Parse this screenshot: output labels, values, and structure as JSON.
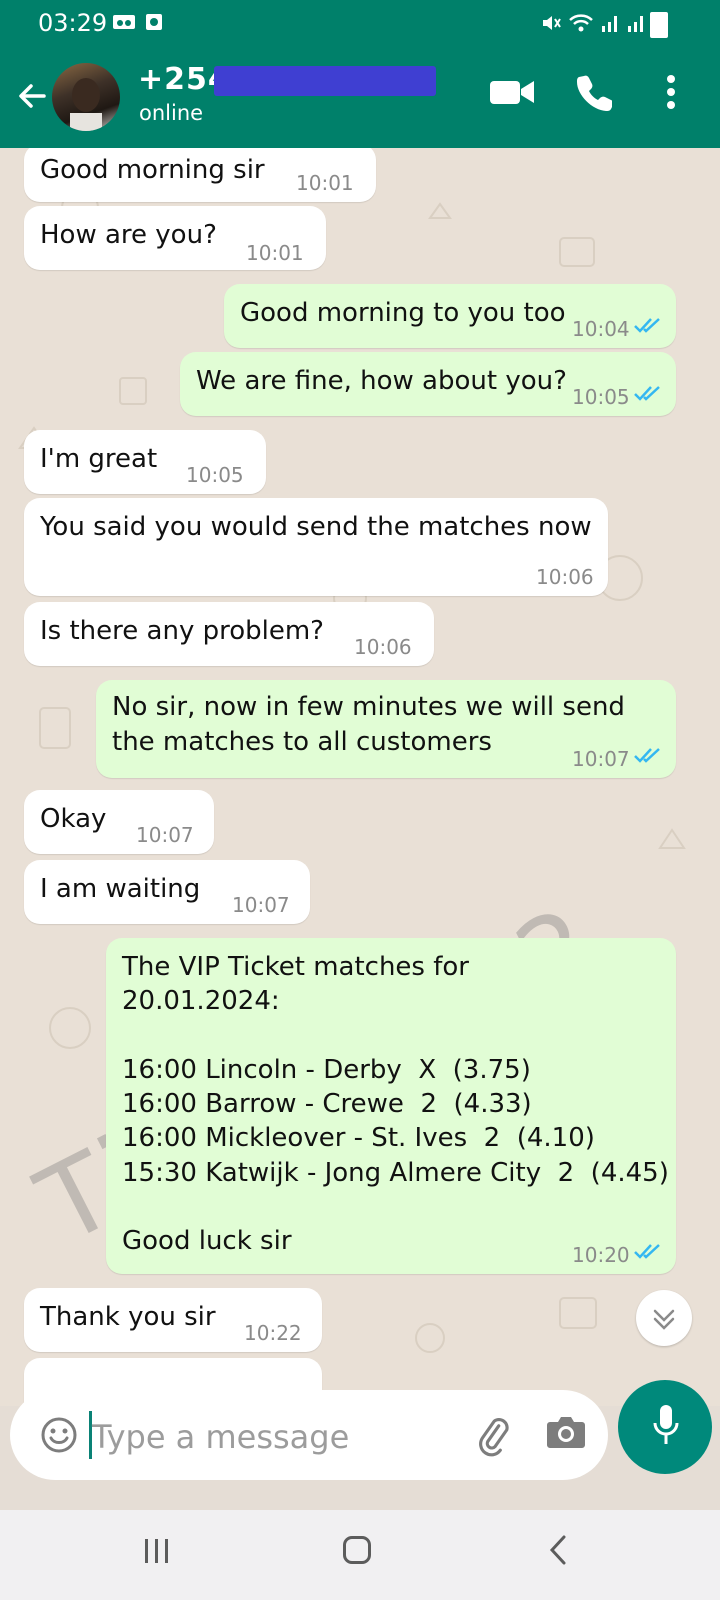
{
  "status_bar": {
    "time": "03:29"
  },
  "header": {
    "contact_name": "+254",
    "status": "online"
  },
  "messages": [
    {
      "side": "in",
      "text": "Good morning sir",
      "time": "10:01"
    },
    {
      "side": "in",
      "text": "How are you?",
      "time": "10:01"
    },
    {
      "side": "out",
      "text": "Good morning to you too",
      "time": "10:04"
    },
    {
      "side": "out",
      "text": "We are fine, how about you?",
      "time": "10:05"
    },
    {
      "side": "in",
      "text": "I'm great",
      "time": "10:05"
    },
    {
      "side": "in",
      "text": "You said you would send the matches now",
      "time": "10:06"
    },
    {
      "side": "in",
      "text": "Is there any problem?",
      "time": "10:06"
    },
    {
      "side": "out",
      "text": "No sir, now in few minutes we will send\nthe matches to all customers",
      "time": "10:07"
    },
    {
      "side": "in",
      "text": "Okay",
      "time": "10:07"
    },
    {
      "side": "in",
      "text": "I am waiting",
      "time": "10:07"
    },
    {
      "side": "out",
      "text": "The VIP Ticket matches for\n20.01.2024:\n\n16:00 Lincoln - Derby  X  (3.75)\n16:00 Barrow - Crewe  2  (4.33)\n16:00 Mickleover - St. Ives  2  (4.10)\n15:30 Katwijk - Jong Almere City  2  (4.45)\n\nGood luck sir",
      "time": "10:20"
    },
    {
      "side": "in",
      "text": "Thank you sir",
      "time": "10:22"
    }
  ],
  "watermark": "Ticket-1x2",
  "composer": {
    "placeholder": "Type a message"
  },
  "colors": {
    "header": "#00806a",
    "outgoing_bubble": "#e1fdd5",
    "incoming_bubble": "#ffffff",
    "read_tick": "#34b7f1",
    "mic_button": "#00897b"
  }
}
